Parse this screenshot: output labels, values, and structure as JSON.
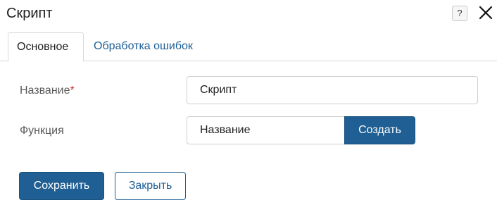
{
  "dialog": {
    "title": "Скрипт",
    "help_glyph": "?",
    "help_icon": "help-icon",
    "close_icon": "close-icon"
  },
  "tabs": [
    {
      "label": "Основное",
      "active": true
    },
    {
      "label": "Обработка ошибок",
      "active": false
    }
  ],
  "form": {
    "name_label": "Название",
    "name_required_mark": "*",
    "name_value": "Скрипт",
    "function_label": "Функция",
    "function_value": "Название",
    "create_button": "Создать"
  },
  "footer": {
    "save_button": "Сохранить",
    "close_button": "Закрыть"
  },
  "colors": {
    "accent": "#1f5f93",
    "link": "#1e5f96",
    "required": "#d0312d"
  }
}
